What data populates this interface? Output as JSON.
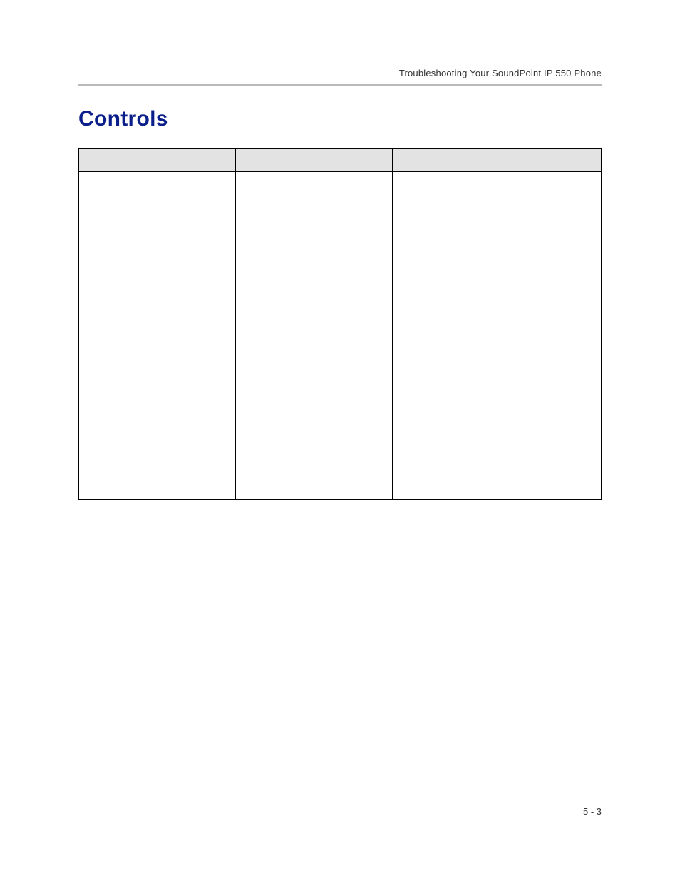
{
  "header": {
    "running_head": "Troubleshooting Your SoundPoint IP 550 Phone"
  },
  "section": {
    "title": "Controls"
  },
  "table": {
    "headers": [
      "",
      "",
      ""
    ],
    "rows": [
      {
        "cells": [
          "",
          "",
          ""
        ]
      }
    ]
  },
  "footer": {
    "page_number": "5 - 3"
  }
}
